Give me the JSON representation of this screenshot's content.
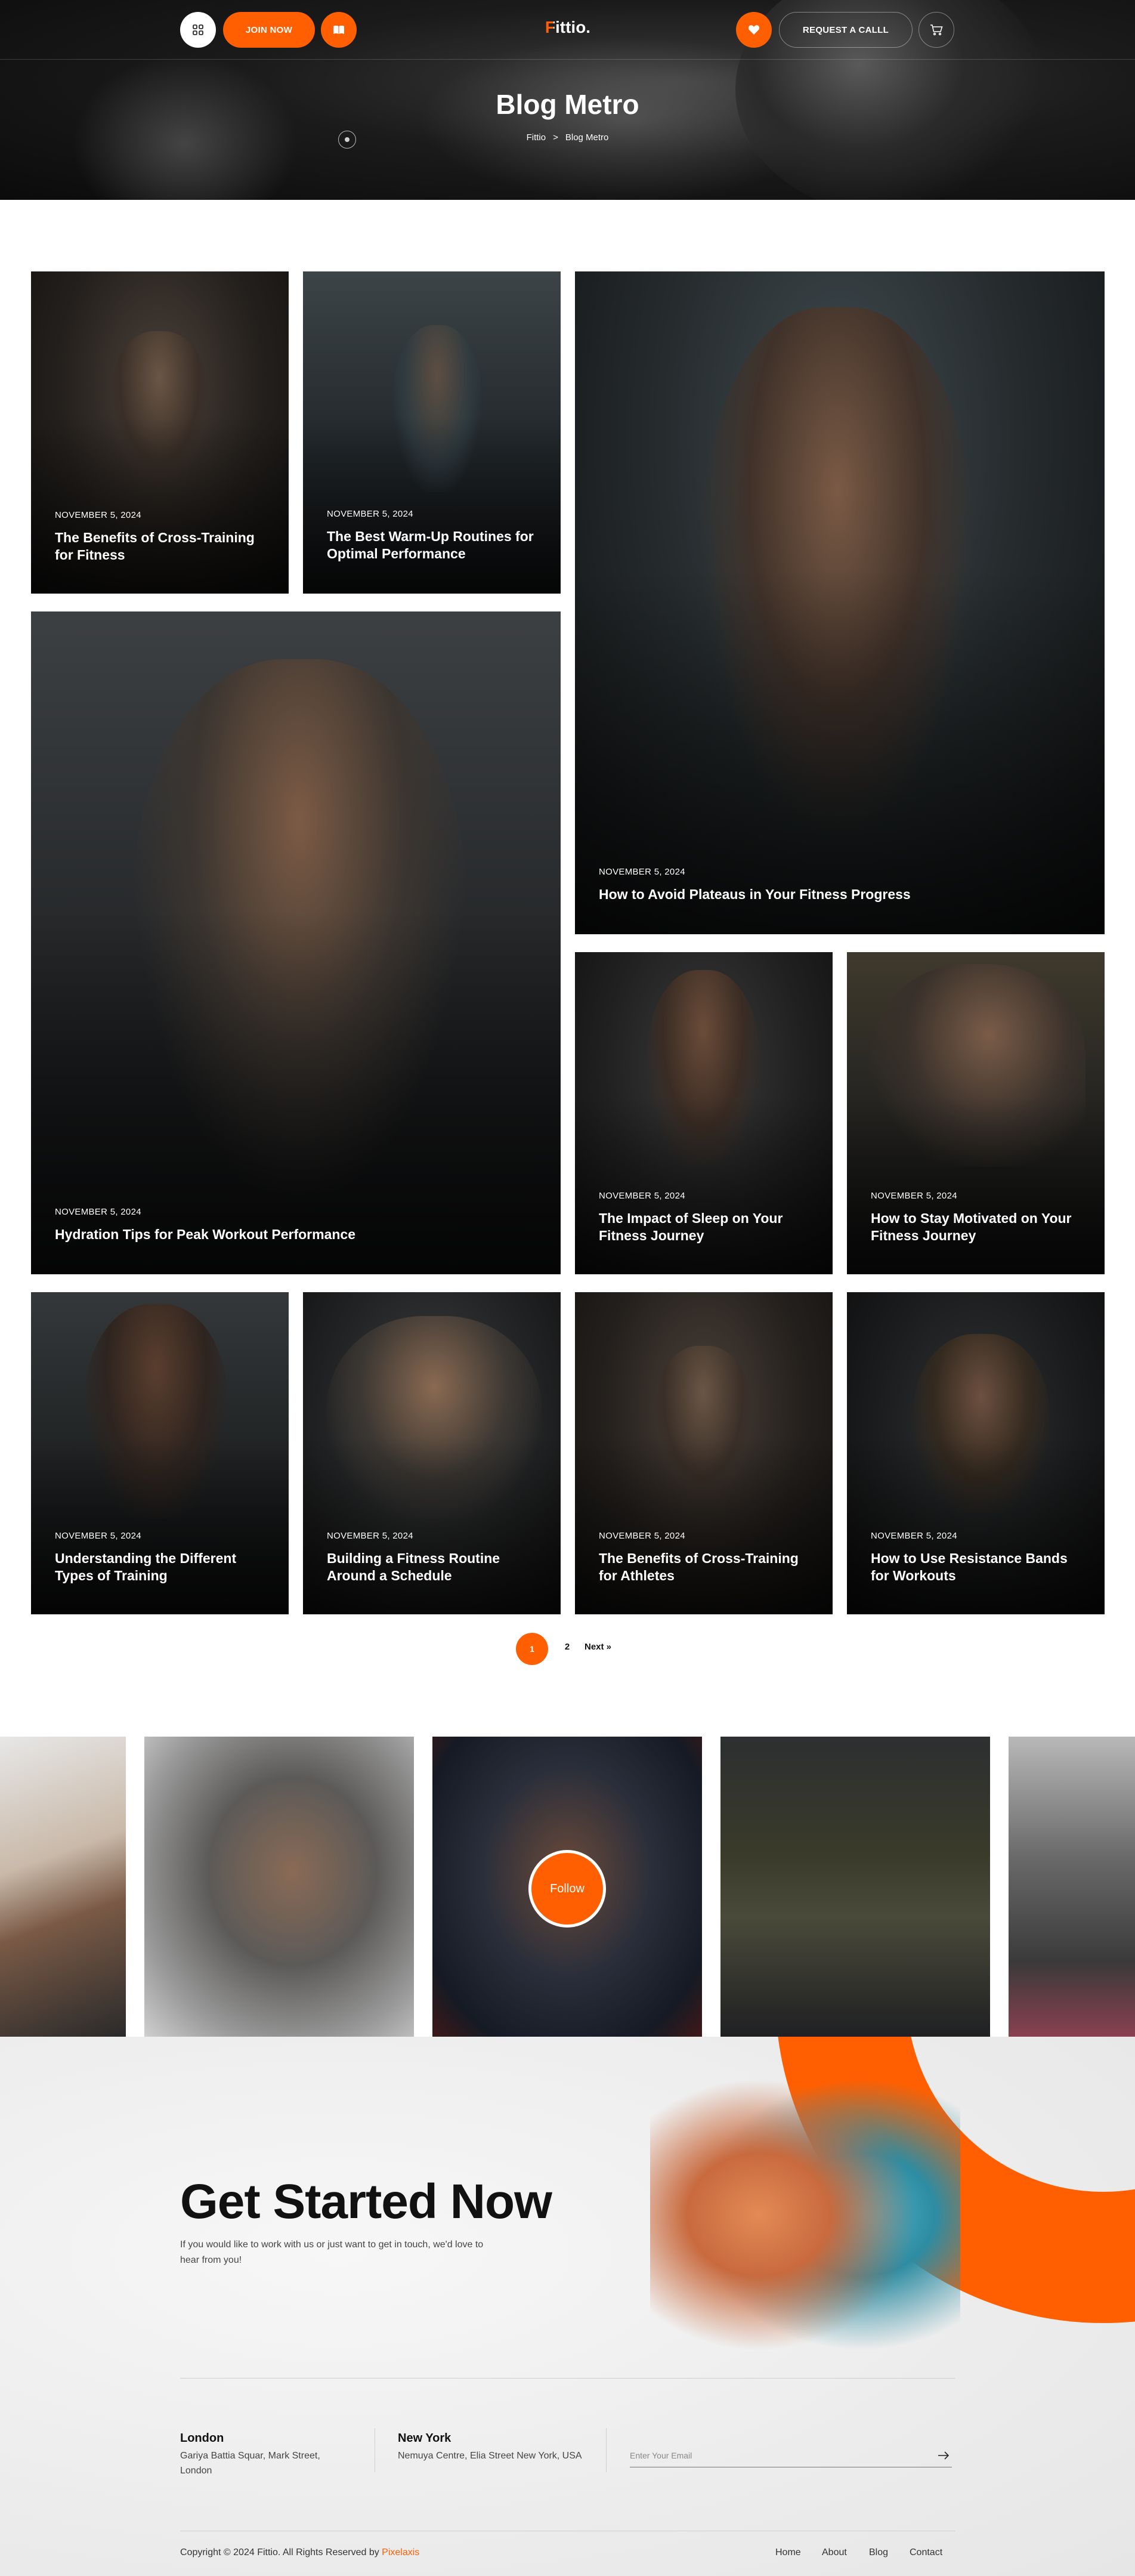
{
  "header": {
    "join_label": "JOIN NOW",
    "logo_text": "Fittio.",
    "request_label": "REQUEST A CALLL",
    "icons": [
      "grid-icon",
      "book-icon",
      "heart-icon",
      "cart-icon"
    ]
  },
  "hero": {
    "title": "Blog Metro",
    "breadcrumb": {
      "home": "Fittio",
      "separator": ">",
      "current": "Blog Metro"
    }
  },
  "posts": [
    {
      "date": "NOVEMBER 5, 2024",
      "title": "The Benefits of Cross-Training for Fitness"
    },
    {
      "date": "NOVEMBER 5, 2024",
      "title": "The Best Warm-Up Routines for Optimal Performance"
    },
    {
      "date": "NOVEMBER 5, 2024",
      "title": "How to Avoid Plateaus in Your Fitness Progress"
    },
    {
      "date": "NOVEMBER 5, 2024",
      "title": "Hydration Tips for Peak Workout Performance"
    },
    {
      "date": "NOVEMBER 5, 2024",
      "title": "The Impact of Sleep on Your Fitness Journey"
    },
    {
      "date": "NOVEMBER 5, 2024",
      "title": "How to Stay Motivated on Your Fitness Journey"
    },
    {
      "date": "NOVEMBER 5, 2024",
      "title": "Understanding the Different Types of Training"
    },
    {
      "date": "NOVEMBER 5, 2024",
      "title": "Building a Fitness Routine Around a Schedule"
    },
    {
      "date": "NOVEMBER 5, 2024",
      "title": "The Benefits of Cross-Training for Athletes"
    },
    {
      "date": "NOVEMBER 5, 2024",
      "title": "How to Use Resistance Bands for Workouts"
    }
  ],
  "pagination": {
    "current": "1",
    "page2": "2",
    "next": "Next »"
  },
  "instagram": {
    "follow_label": "Follow"
  },
  "cta": {
    "title": "Get Started Now",
    "subtitle": "If you would like to work with us or just want to get in touch, we'd love to hear from you!"
  },
  "contacts": [
    {
      "city": "London",
      "address": "Gariya Battia Squar, Mark Street, London"
    },
    {
      "city": "New York",
      "address": "Nemuya Centre, Elia Street New York, USA"
    }
  ],
  "newsletter": {
    "placeholder": "Enter Your Email"
  },
  "footer": {
    "copyright": "Copyright © 2024 Fittio. All Rights Reserved by ",
    "brand": "Pixelaxis",
    "nav": [
      "Home",
      "About",
      "Blog",
      "Contact"
    ]
  },
  "colors": {
    "accent": "#ff5f00",
    "dark": "#0b0b0b",
    "light_bg": "#ececec"
  }
}
